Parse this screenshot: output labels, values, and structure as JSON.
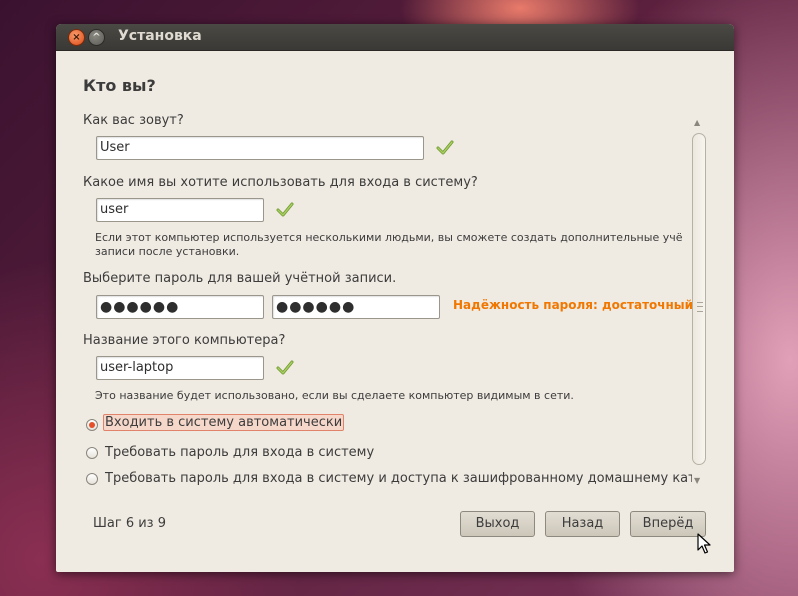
{
  "window": {
    "title": "Установка"
  },
  "page": {
    "heading": "Кто вы?"
  },
  "name": {
    "label": "Как вас зовут?",
    "value": "User"
  },
  "login": {
    "label": "Какое имя вы хотите использовать для входа в систему?",
    "value": "user",
    "hint_line1": "Если этот компьютер используется несколькими людьми, вы сможете создать дополнительные учё",
    "hint_line2": "записи после установки."
  },
  "password": {
    "label": "Выберите пароль для вашей учётной записи.",
    "value": "●●●●●●",
    "confirm_value": "●●●●●●",
    "strength": "Надёжность пароля: достаточный"
  },
  "hostname": {
    "label": "Название этого компьютера?",
    "value": "user-laptop",
    "hint": "Это название будет использовано, если вы сделаете компьютер видимым в сети."
  },
  "login_options": [
    {
      "label": "Входить в систему автоматически",
      "selected": true
    },
    {
      "label": "Требовать пароль для входа в систему",
      "selected": false
    },
    {
      "label": "Требовать пароль для входа в систему и доступа к зашифрованному домашнему каталогу",
      "selected": false
    }
  ],
  "footer": {
    "step": "Шаг 6 из 9",
    "quit": "Выход",
    "back": "Назад",
    "forward": "Вперёд"
  },
  "colors": {
    "strength": "#f07700",
    "check": "#8cb34a",
    "radio_selected": "#e5502a"
  },
  "icons": {
    "check": "check-icon",
    "close": "close-icon",
    "minimize": "minimize-icon"
  }
}
